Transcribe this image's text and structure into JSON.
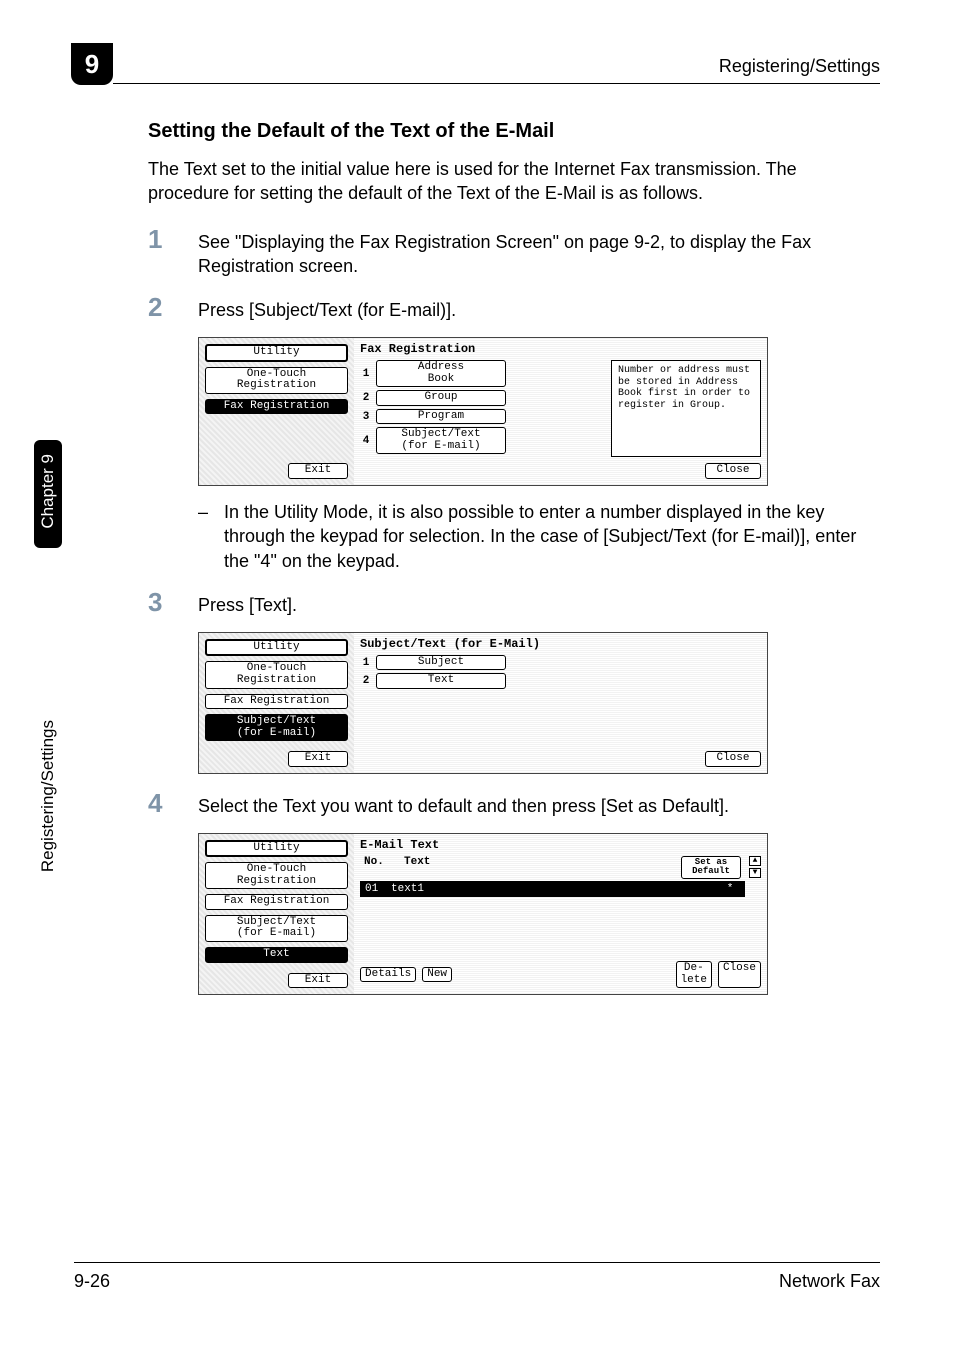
{
  "page": {
    "section_number": "9",
    "header_right": "Registering/Settings",
    "sidebar_chapter": "Chapter 9",
    "sidebar_section": "Registering/Settings",
    "footer_left": "9-26",
    "footer_right": "Network Fax"
  },
  "heading": "Setting the Default of the Text of the E-Mail",
  "intro": "The Text set to the initial value here is used for the Internet Fax transmission. The procedure for setting the default of the Text of the E-Mail is as follows.",
  "steps": {
    "s1": {
      "num": "1",
      "text": "See \"Displaying the Fax Registration Screen\" on page 9-2, to display the Fax Registration screen."
    },
    "s2": {
      "num": "2",
      "text": "Press [Subject/Text (for E-mail)]."
    },
    "s2_note": "In the Utility Mode, it is also possible to enter a number displayed in the key through the keypad for selection. In the case of [Subject/Text (for E-mail)], enter the \"4\" on the keypad.",
    "s3": {
      "num": "3",
      "text": "Press [Text]."
    },
    "s4": {
      "num": "4",
      "text": "Select the Text you want to default and then press [Set as Default]."
    }
  },
  "lcd1": {
    "title": "Fax Registration",
    "left": {
      "utility": "Utility",
      "one_touch": "One-Touch\nRegistration",
      "fax_reg": "Fax Registration",
      "exit": "Exit"
    },
    "menu": {
      "m1": "Address\nBook",
      "m2": "Group",
      "m3": "Program",
      "m4": "Subject/Text\n(for E-mail)"
    },
    "note": "Number or address must be stored in Address Book first in order to register in Group.",
    "close": "Close"
  },
  "lcd2": {
    "title": "Subject/Text (for E-Mail)",
    "left": {
      "utility": "Utility",
      "one_touch": "One-Touch\nRegistration",
      "fax_reg": "Fax Registration",
      "subj": "Subject/Text\n(for E-mail)",
      "exit": "Exit"
    },
    "menu": {
      "m1": "Subject",
      "m2": "Text"
    },
    "close": "Close"
  },
  "lcd3": {
    "title": "E-Mail Text",
    "left": {
      "utility": "Utility",
      "one_touch": "One-Touch\nRegistration",
      "fax_reg": "Fax Registration",
      "subj": "Subject/Text\n(for E-mail)",
      "text": "Text",
      "exit": "Exit"
    },
    "head": {
      "no": "No.",
      "text": "Text",
      "setdef": "Set as\nDefault"
    },
    "row": {
      "no": "01",
      "text": "text1",
      "star": "*"
    },
    "buttons": {
      "details": "Details",
      "new": "New",
      "delete": "De-\nlete",
      "close": "Close"
    }
  }
}
